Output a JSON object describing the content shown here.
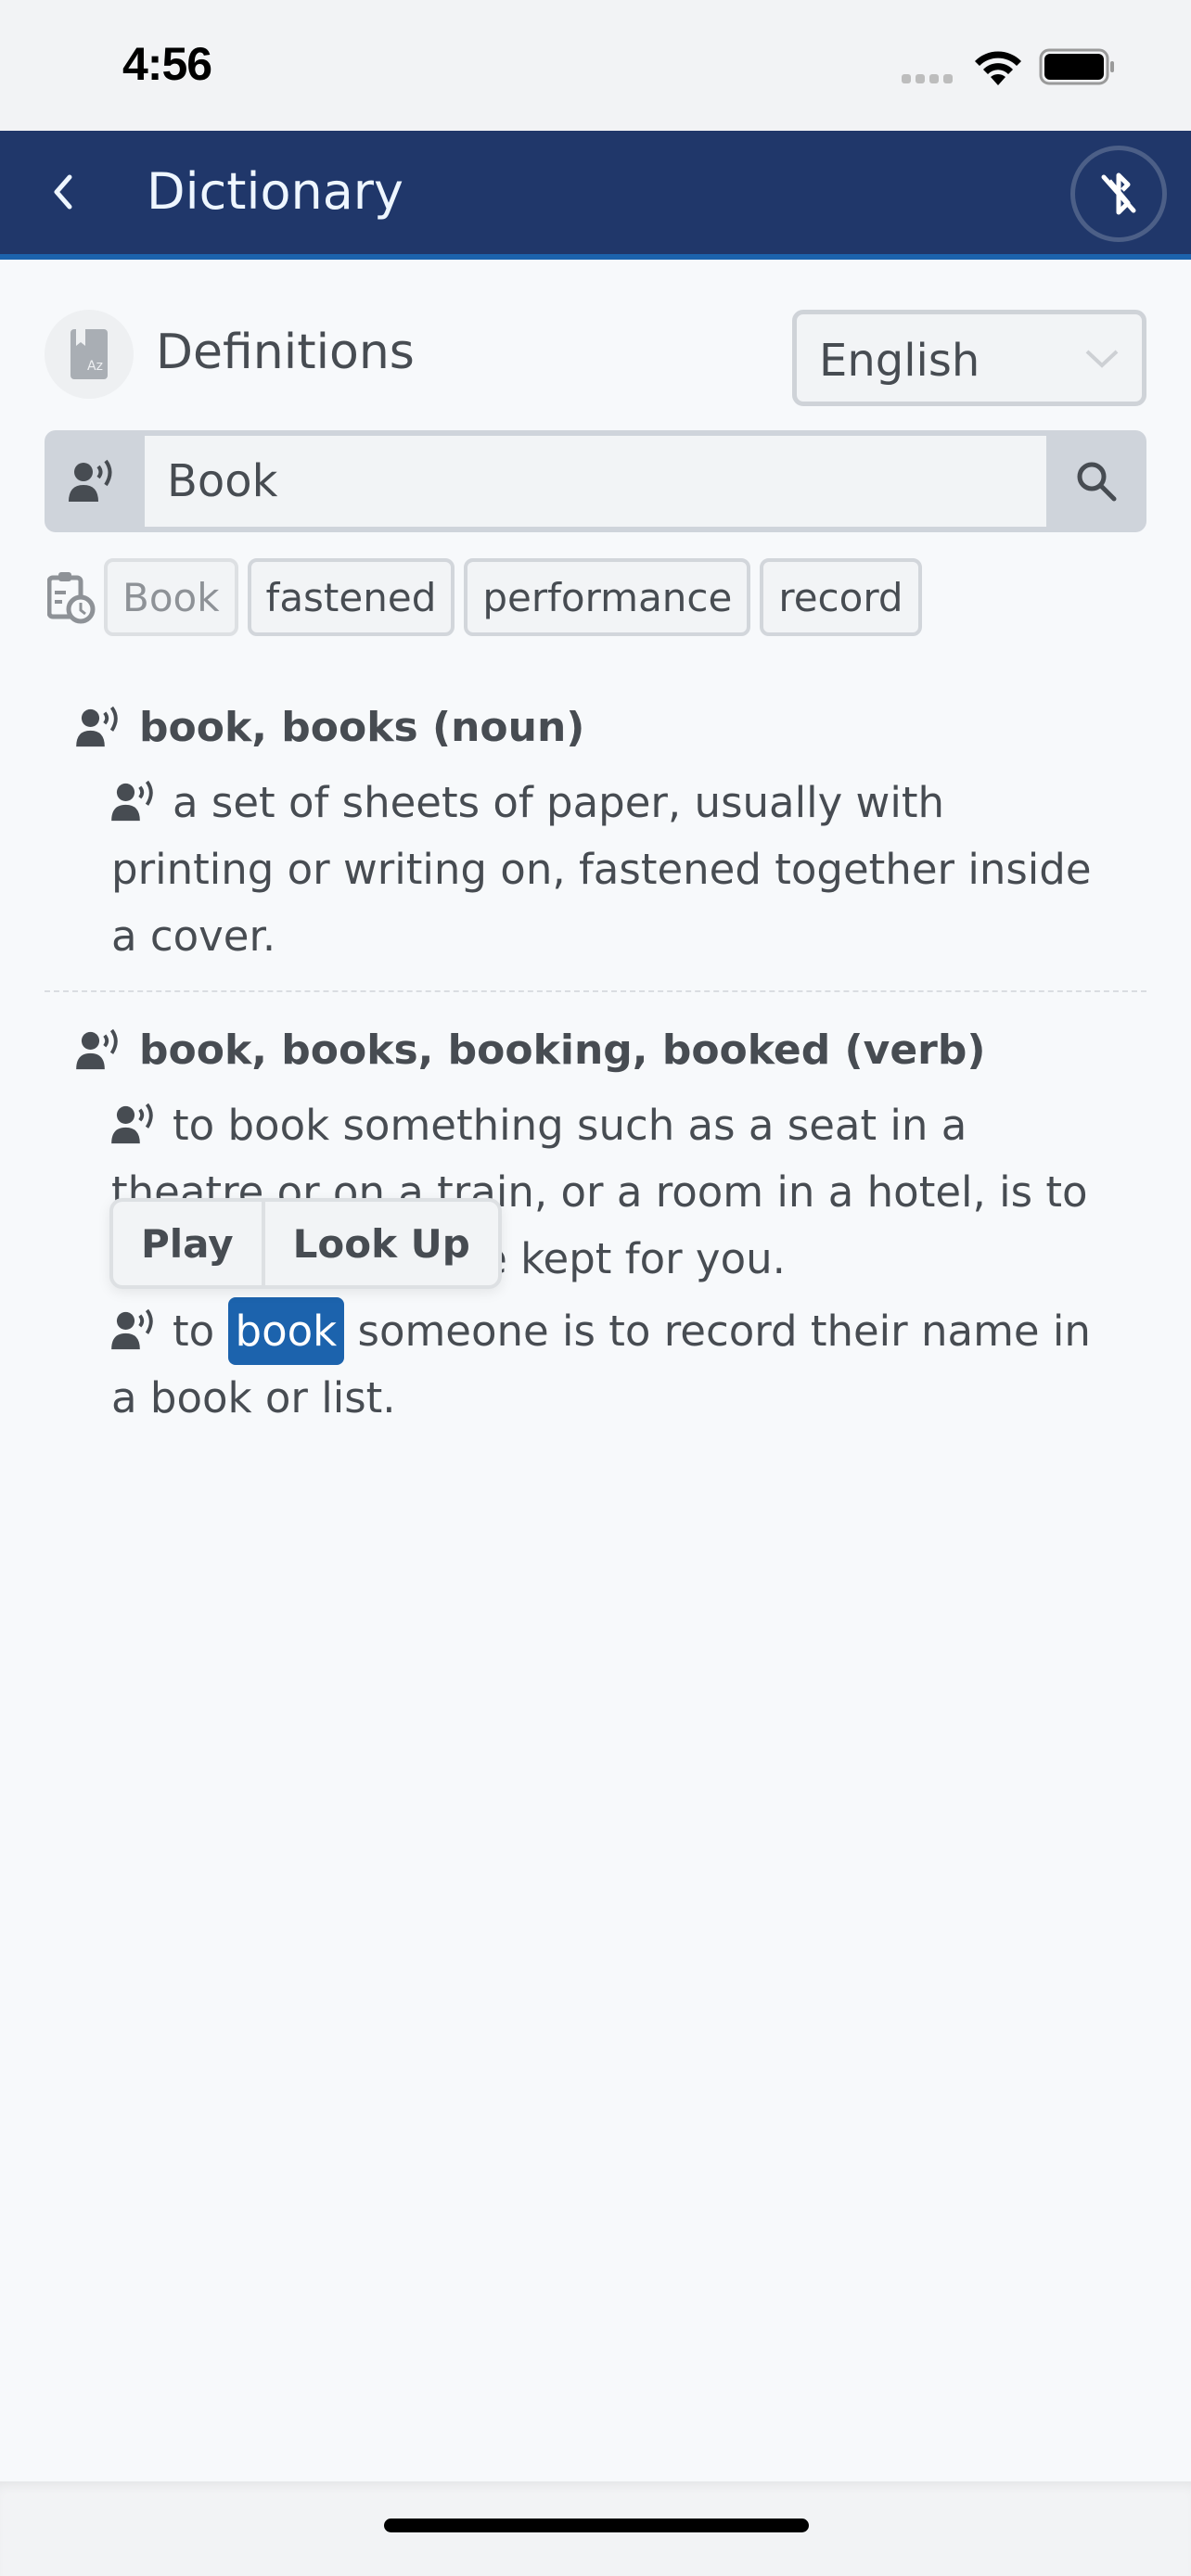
{
  "status_bar": {
    "time": "4:56",
    "icons": [
      "signal-dots-icon",
      "wifi-icon",
      "battery-icon"
    ]
  },
  "nav": {
    "back_icon": "chevron-left-icon",
    "title": "Dictionary",
    "right_icon": "bluetooth-disabled-icon"
  },
  "definitions": {
    "icon": "dictionary-book-az-icon",
    "title": "Definitions",
    "language": {
      "selected": "English"
    }
  },
  "search": {
    "speak_icon": "speaker-person-icon",
    "value": "Book",
    "placeholder": "",
    "search_icon": "search-icon"
  },
  "history": {
    "icon": "clipboard-clock-icon",
    "chips": [
      {
        "label": "Book",
        "current": true
      },
      {
        "label": "fastened",
        "current": false
      },
      {
        "label": "performance",
        "current": false
      },
      {
        "label": "record",
        "current": false
      }
    ]
  },
  "entries": [
    {
      "headword": "book, books (noun)",
      "senses": [
        {
          "text": "a set of sheets of paper, usually with printing or writing on, fastened together inside a cover."
        }
      ]
    },
    {
      "headword": "book, books, booking, booked (verb)",
      "senses": [
        {
          "text": "to book something such as a seat in a theatre or on a train, or a room in a hotel, is to arrange for it to be kept for you."
        },
        {
          "before": "to",
          "highlight": "book",
          "after": "someone is to record their name in a book or list."
        }
      ]
    }
  ],
  "context_menu": {
    "items": [
      "Play",
      "Look Up"
    ]
  },
  "colors": {
    "nav_bg": "#20376a",
    "nav_accent": "#1c63ad",
    "highlight": "#1c63ad",
    "text": "#474c52",
    "page_bg": "#f7f9fb"
  }
}
